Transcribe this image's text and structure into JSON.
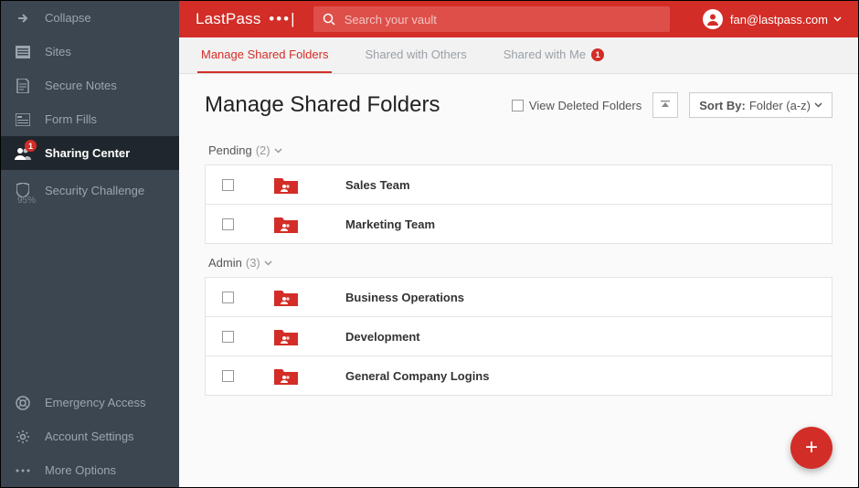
{
  "sidebar": {
    "collapse": "Collapse",
    "items": [
      {
        "label": "Sites"
      },
      {
        "label": "Secure Notes"
      },
      {
        "label": "Form Fills"
      },
      {
        "label": "Sharing Center",
        "badge": "1"
      },
      {
        "label": "Security Challenge",
        "sub": "95%"
      }
    ],
    "bottom": [
      {
        "label": "Emergency Access"
      },
      {
        "label": "Account Settings"
      },
      {
        "label": "More Options"
      }
    ]
  },
  "header": {
    "logo": "LastPass",
    "search_placeholder": "Search your vault",
    "user": "fan@lastpass.com"
  },
  "tabs": [
    {
      "label": "Manage Shared Folders",
      "active": true
    },
    {
      "label": "Shared with Others"
    },
    {
      "label": "Shared with Me",
      "badge": "1"
    }
  ],
  "page": {
    "title": "Manage Shared Folders",
    "view_deleted": "View Deleted Folders",
    "sort_label": "Sort By:",
    "sort_value": "Folder (a-z)"
  },
  "groups": [
    {
      "name": "Pending",
      "count": "(2)",
      "rows": [
        "Sales Team",
        "Marketing Team"
      ]
    },
    {
      "name": "Admin",
      "count": "(3)",
      "rows": [
        "Business Operations",
        "Development",
        "General Company Logins"
      ]
    }
  ]
}
